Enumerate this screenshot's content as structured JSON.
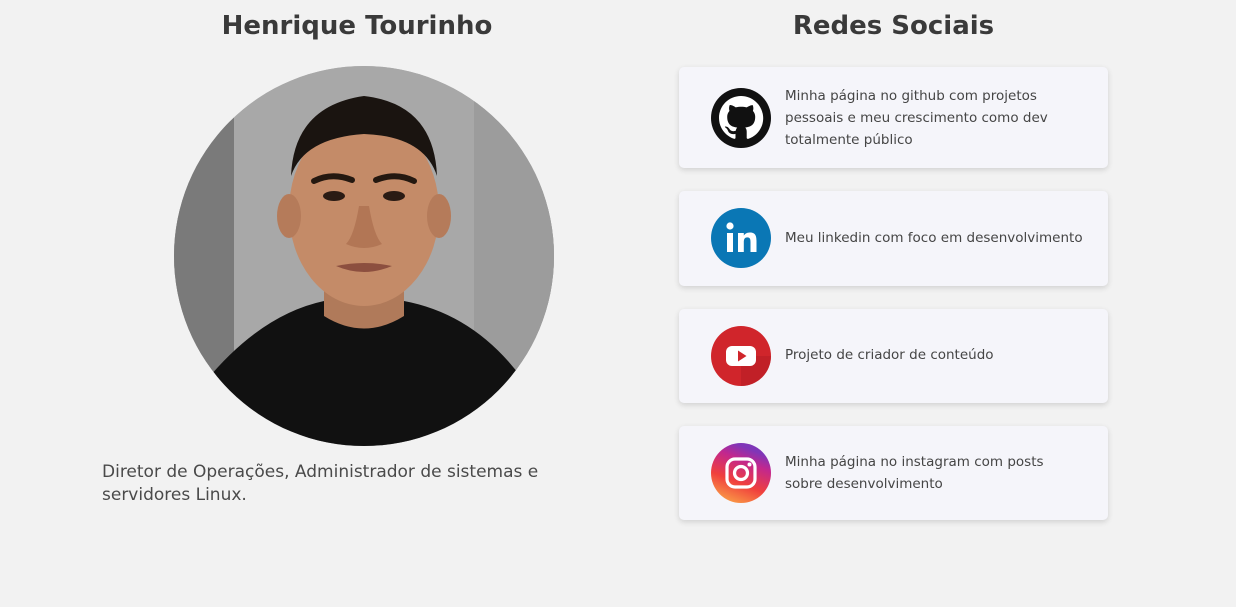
{
  "profile": {
    "name": "Henrique Tourinho",
    "bio": "Diretor de Operações, Administrador de sistemas e servidores Linux."
  },
  "social": {
    "title": "Redes Sociais",
    "cards": [
      {
        "icon": "github-icon",
        "text": "Minha página no github com projetos pessoais e meu crescimento como dev totalmente público"
      },
      {
        "icon": "linkedin-icon",
        "text": "Meu linkedin com foco em desenvolvimento"
      },
      {
        "icon": "youtube-icon",
        "text": "Projeto de criador de conteúdo"
      },
      {
        "icon": "instagram-icon",
        "text": "Minha página no instagram com posts sobre desenvolvimento"
      }
    ]
  },
  "colors": {
    "background": "#f2f2f2",
    "card_background": "#f5f5fa",
    "linkedin_blue": "#0a77b5",
    "youtube_red": "#d0252b",
    "github_black": "#111111"
  }
}
